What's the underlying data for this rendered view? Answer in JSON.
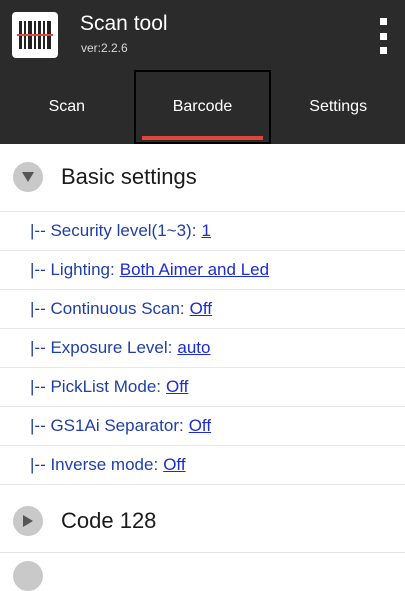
{
  "appbar": {
    "icon": "barcode-icon",
    "title": "Scan tool",
    "version": "ver:2.2.6",
    "overflow_icon": "overflow-menu-icon"
  },
  "tabs": [
    {
      "label": "Scan",
      "selected": false
    },
    {
      "label": "Barcode",
      "selected": true
    },
    {
      "label": "Settings",
      "selected": false
    }
  ],
  "accent_color": "#e0463e",
  "groups": {
    "basic": {
      "label": "Basic settings",
      "icon": "expanded-arrow-icon"
    },
    "code128": {
      "label": "Code 128",
      "icon": "collapsed-arrow-icon"
    }
  },
  "settings": [
    {
      "label": "|-- Security level(1~3):",
      "value": "1"
    },
    {
      "label": "|-- Lighting:",
      "value": "Both Aimer and Led"
    },
    {
      "label": "|-- Continuous Scan:",
      "value": "Off"
    },
    {
      "label": "|-- Exposure Level:",
      "value": "auto"
    },
    {
      "label": "|-- PickList Mode:",
      "value": "Off"
    },
    {
      "label": "|-- GS1Ai Separator:",
      "value": "Off"
    },
    {
      "label": "|-- Inverse mode:",
      "value": "Off"
    }
  ]
}
